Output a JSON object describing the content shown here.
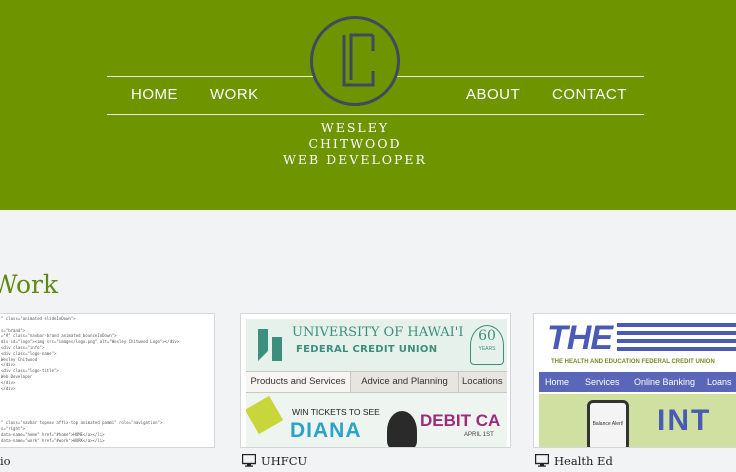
{
  "header": {
    "nav": {
      "home": "HOME",
      "work": "WORK",
      "about": "ABOUT",
      "contact": "CONTACT"
    },
    "tagline": [
      "WESLEY",
      "CHITWOOD",
      "WEB DEVELOPER"
    ],
    "colors": {
      "background": "#6e9400",
      "logo_stroke": "#3f4a5c"
    }
  },
  "work": {
    "title": "Work",
    "cards": [
      {
        "label": "io",
        "icon": "monitor-icon"
      },
      {
        "label": "UHFCU",
        "icon": "monitor-icon"
      },
      {
        "label": "Health Ed",
        "icon": "monitor-icon"
      }
    ]
  },
  "uhfcu_preview": {
    "name_line1": "UNIVERSITY OF HAWAI'I",
    "name_line2": "FEDERAL CREDIT UNION",
    "badge": "60",
    "badge_sub": "YEARS",
    "tabs": [
      "Products and Services",
      "Advice and Planning",
      "Locations"
    ],
    "ticket": "WIN TICKETS TO SEE",
    "star": "DIANA",
    "debit": "DEBIT CA",
    "date": "APRIL 1ST"
  },
  "healthed_preview": {
    "logo": "THE",
    "subtitle": "THE HEALTH AND EDUCATION FEDERAL CREDIT UNION",
    "nav": [
      "Home",
      "Services",
      "Online Banking",
      "Loans"
    ],
    "banner": "INT",
    "phone_text": "Balance Alert!"
  },
  "code_preview": {
    "lines": [
      "\" class=\"animated slideInDown\">",
      "",
      "s=\"brand\">",
      "=\"#\" class=\"navbar-brand animated bounceInDown\">",
      "  div id=\"logo\"><img src=\"images/logo.png\" alt=\"Wesley Chitwood Logo\"></div>",
      "   <div class=\"info\">",
      "     <div class=\"logo-name\">",
      "       Wesley Chitwood",
      "     </div>",
      "     <div class=\"logo-title\">",
      "       Web Developer",
      "     </div>",
      "   </div>",
      "",
      "",
      "",
      "",
      "",
      "\" class=\"navbar topnav affix-top animated pammi\" role=\"navigation\">",
      "s=\"right\">",
      "  data-name=\"home\" href=\"#home\">HOME</a></li>",
      "  data-name=\"work\" href=\"#work\">WORK</a></li>"
    ]
  }
}
